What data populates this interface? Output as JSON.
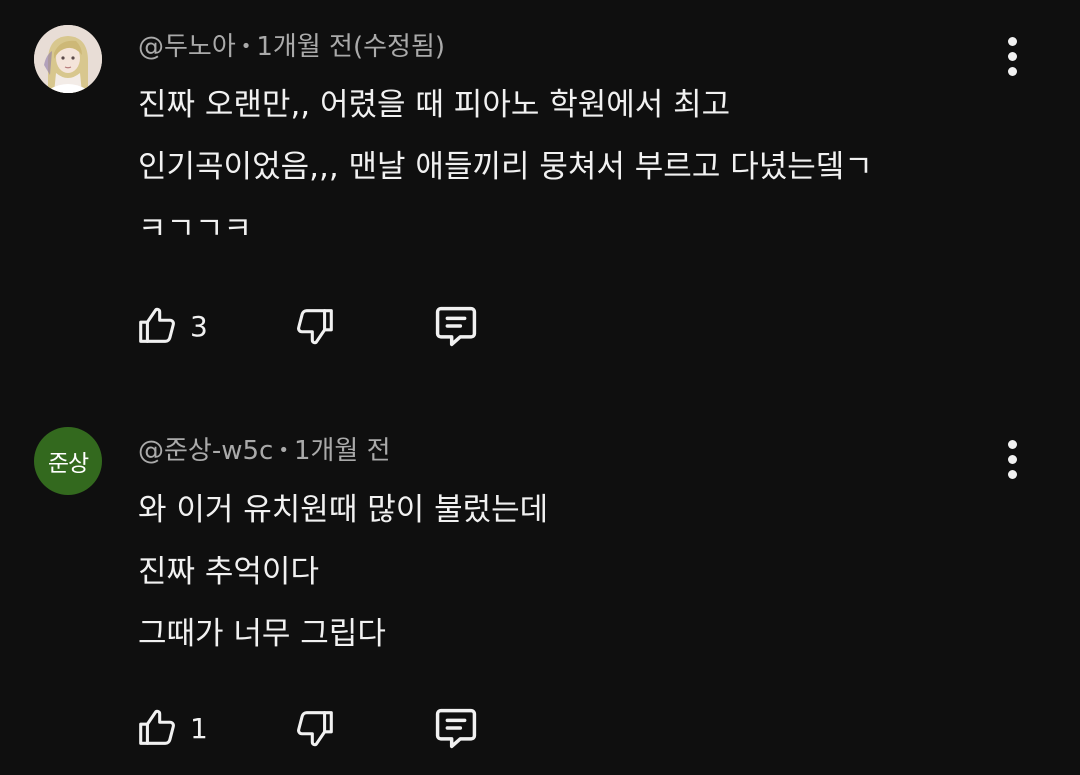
{
  "comments": [
    {
      "author": "@두노아",
      "time": "1개월 전(수정됨)",
      "lines": [
        "진짜 오랜만,, 어렸을 때 피아노 학원에서 최고",
        "인기곡이었음,,, 맨날 애들끼리 뭉쳐서 부르고 다녔는뎈ㄱ",
        "ㅋㄱㄱㅋ"
      ],
      "likes": "3",
      "avatar_icon": "anime-portrait-avatar"
    },
    {
      "author": "@준상-w5c",
      "time": "1개월 전",
      "lines": [
        "와 이거 유치원때 많이 불렀는데",
        "진짜 추억이다",
        "그때가 너무 그립다"
      ],
      "likes": "1",
      "avatar_text": "준상",
      "avatar_color": "#33691e"
    }
  ],
  "separator": "•",
  "icons": {
    "like": "thumbs-up-icon",
    "dislike": "thumbs-down-icon",
    "reply": "reply-comment-icon",
    "menu": "more-vert-icon"
  }
}
